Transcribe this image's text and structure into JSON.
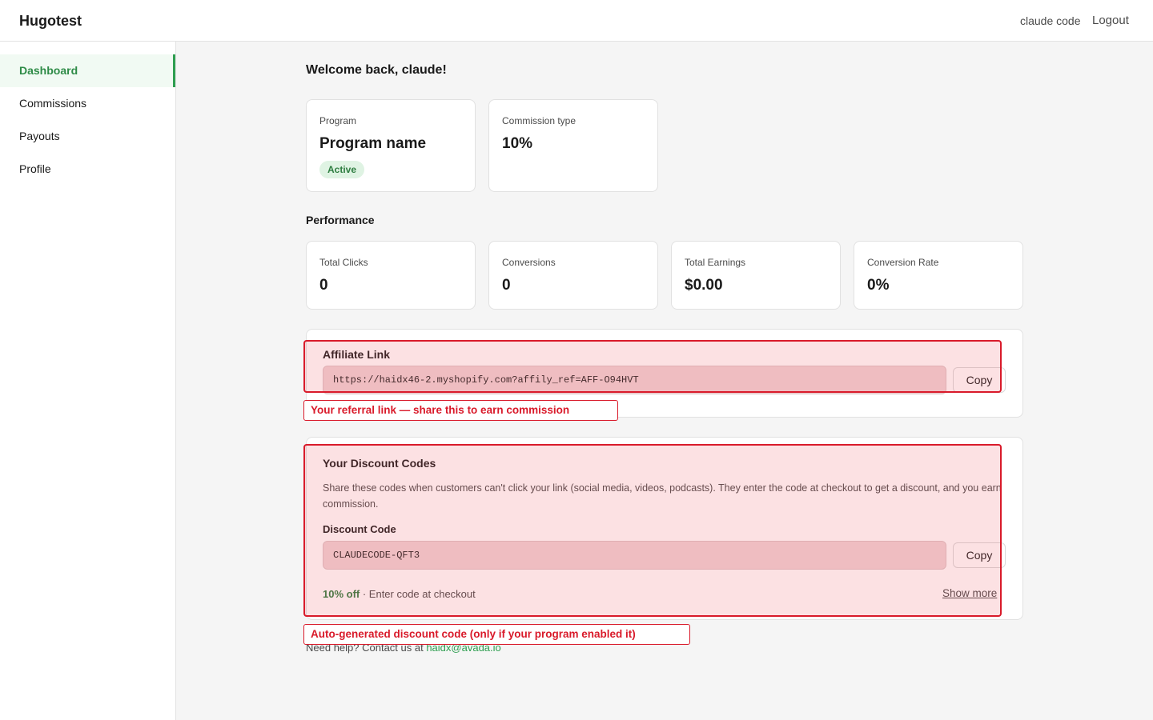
{
  "header": {
    "brand": "Hugotest",
    "user": "claude code",
    "logout": "Logout"
  },
  "sidebar": {
    "items": [
      {
        "label": "Dashboard",
        "active": true
      },
      {
        "label": "Commissions",
        "active": false
      },
      {
        "label": "Payouts",
        "active": false
      },
      {
        "label": "Profile",
        "active": false
      }
    ]
  },
  "main": {
    "welcome": "Welcome back, claude!",
    "program": {
      "label": "Program",
      "name": "Program name",
      "status": "Active"
    },
    "commission": {
      "label": "Commission type",
      "value": "10%"
    },
    "performance": {
      "title": "Performance",
      "stats": [
        {
          "label": "Total Clicks",
          "value": "0"
        },
        {
          "label": "Conversions",
          "value": "0"
        },
        {
          "label": "Total Earnings",
          "value": "$0.00"
        },
        {
          "label": "Conversion Rate",
          "value": "0%"
        }
      ]
    },
    "affiliate": {
      "title": "Affiliate Link",
      "url": "https://haidx46-2.myshopify.com?affily_ref=AFF-O94HVT",
      "copy": "Copy"
    },
    "discount": {
      "title": "Your Discount Codes",
      "description": "Share these codes when customers can't click your link (social media, videos, podcasts). They enter the code at checkout to get a discount, and you earn commission.",
      "code_label": "Discount Code",
      "code": "CLAUDECODE-QFT3",
      "copy": "Copy",
      "off": "10% off",
      "note": " · Enter code at checkout",
      "show_more": "Show more"
    },
    "help": {
      "text": "Need help? Contact us at ",
      "email": "haidx@avada.io"
    }
  },
  "annotations": {
    "affiliate": "Your referral link — share this to earn commission",
    "discount": "Auto-generated discount code (only if your program enabled it)"
  },
  "colors": {
    "accent": "#2e9e50",
    "annotation": "#d91a2a"
  }
}
